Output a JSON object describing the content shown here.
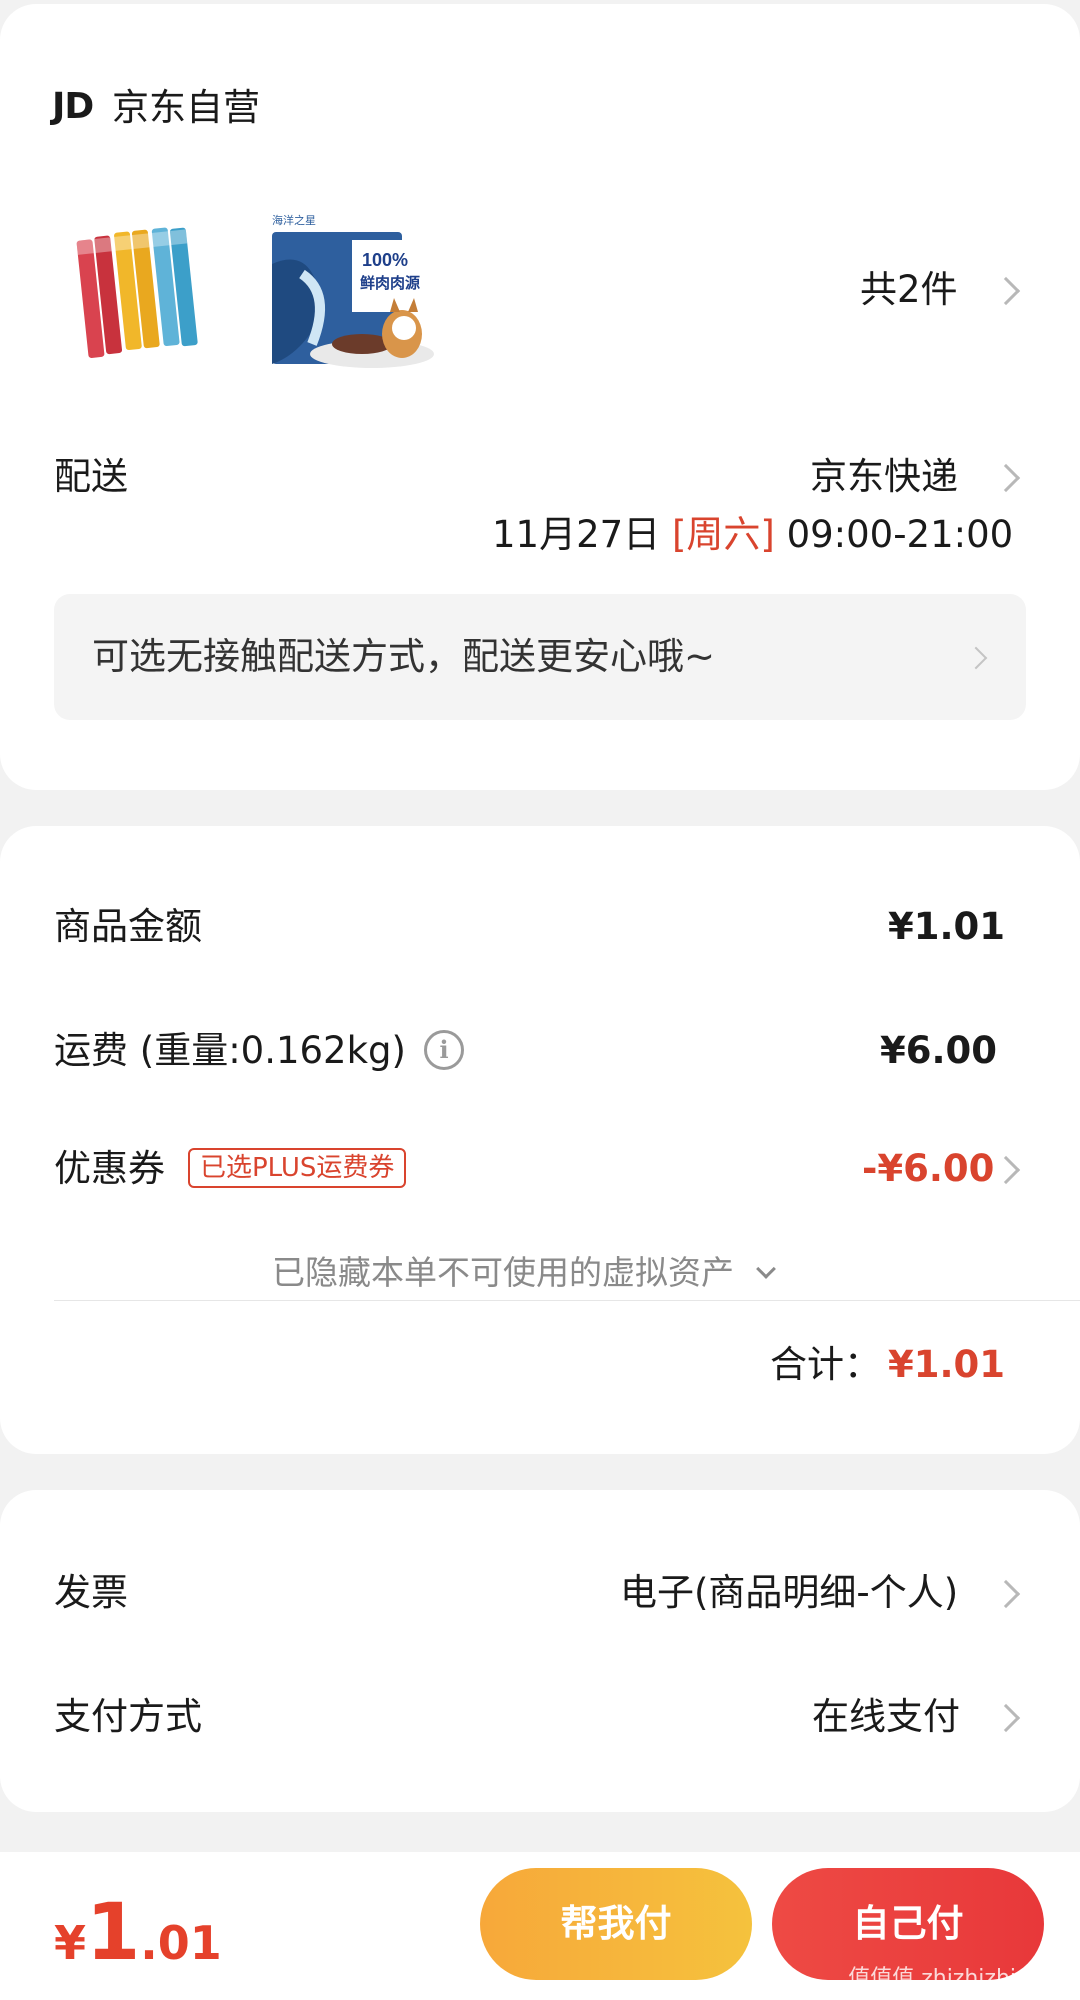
{
  "shop": {
    "logo": "JD",
    "name": "京东自营",
    "products": [
      {
        "name": "tube-treats-product",
        "image": "cat-treat-tubes"
      },
      {
        "name": "dog-food-bag-product",
        "image": "dog-food-bag",
        "bag_text_1": "100%",
        "bag_text_2": "鲜肉肉源",
        "bag_brand": "海洋之星"
      }
    ],
    "count_label": "共2件"
  },
  "delivery": {
    "label": "配送",
    "method": "京东快递",
    "date": "11月27日",
    "weekday": "[周六]",
    "time": "09:00-21:00",
    "notice": "可选无接触配送方式，配送更安心哦~"
  },
  "price": {
    "goods_label": "商品金额",
    "goods_value": "¥1.01",
    "shipping_label": "运费",
    "shipping_weight": "(重量:0.162kg)",
    "shipping_value": "¥6.00",
    "coupon_label": "优惠券",
    "coupon_tag": "已选PLUS运费券",
    "coupon_value": "-¥6.00",
    "hidden_assets": "已隐藏本单不可使用的虚拟资产",
    "total_label": "合计：",
    "total_value": "¥1.01"
  },
  "invoice": {
    "label": "发票",
    "value": "电子(商品明细-个人)",
    "payment_label": "支付方式",
    "payment_value": "在线支付"
  },
  "bottom": {
    "currency": "¥",
    "total_int": "1",
    "total_dec": ".01",
    "help_pay": "帮我付",
    "self_pay": "自己付",
    "watermark": "值值值 zhizhizhi.com"
  },
  "colors": {
    "accent_red": "#d9442e",
    "help_yellow": "#f5b83a",
    "self_red": "#ea4040"
  }
}
